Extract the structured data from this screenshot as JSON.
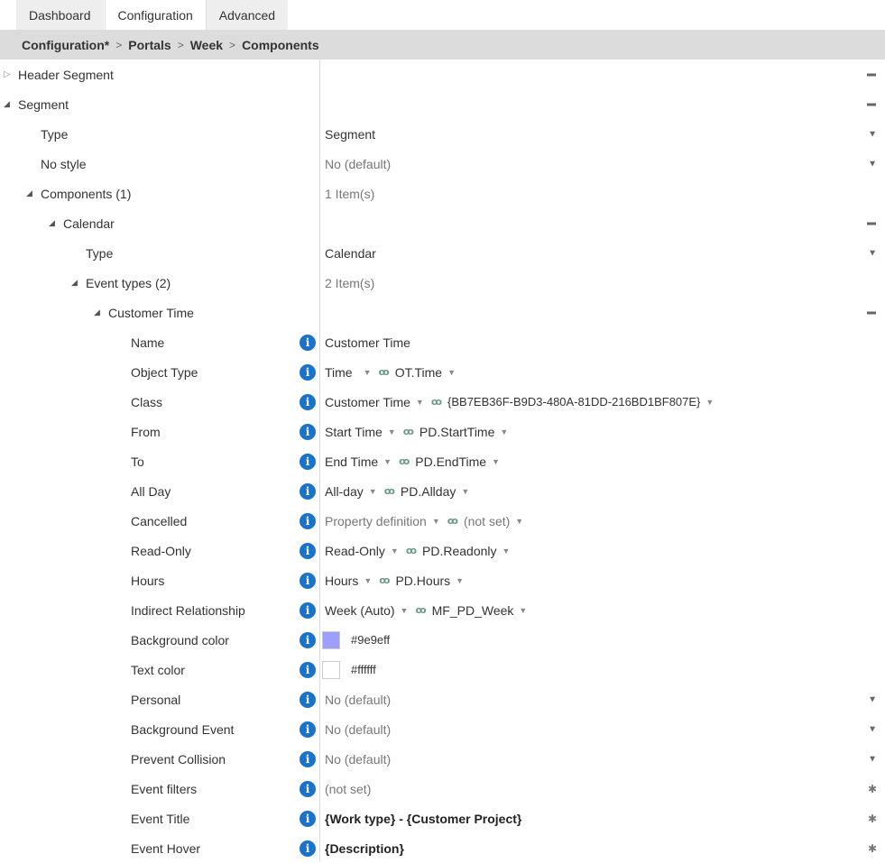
{
  "tabs": [
    {
      "label": "Dashboard",
      "active": false
    },
    {
      "label": "Configuration",
      "active": true
    },
    {
      "label": "Advanced",
      "active": false
    }
  ],
  "breadcrumb": [
    "Configuration*",
    "Portals",
    "Week",
    "Components"
  ],
  "breadcrumb_separator": ">",
  "tree": {
    "header_segment": {
      "label": "Header Segment"
    },
    "segment": {
      "label": "Segment"
    },
    "segment_type": {
      "label": "Type",
      "value": "Segment"
    },
    "segment_no_style": {
      "label": "No style",
      "value": "No (default)"
    },
    "components": {
      "label": "Components (1)",
      "value": "1 Item(s)"
    },
    "calendar": {
      "label": "Calendar"
    },
    "calendar_type": {
      "label": "Type",
      "value": "Calendar"
    },
    "event_types": {
      "label": "Event types (2)",
      "value": "2 Item(s)"
    },
    "customer_time": {
      "label": "Customer Time"
    }
  },
  "props": {
    "name": {
      "label": "Name",
      "value": "Customer Time"
    },
    "object_type": {
      "label": "Object Type",
      "value": "Time",
      "alias": "OT.Time"
    },
    "class": {
      "label": "Class",
      "value": "Customer Time",
      "alias": "{BB7EB36F-B9D3-480A-81DD-216BD1BF807E}"
    },
    "from": {
      "label": "From",
      "value": "Start Time",
      "alias": "PD.StartTime"
    },
    "to": {
      "label": "To",
      "value": "End Time",
      "alias": "PD.EndTime"
    },
    "all_day": {
      "label": "All Day",
      "value": "All-day",
      "alias": "PD.Allday"
    },
    "cancelled": {
      "label": "Cancelled",
      "value": "Property definition",
      "alias": "(not set)"
    },
    "read_only": {
      "label": "Read-Only",
      "value": "Read-Only",
      "alias": "PD.Readonly"
    },
    "hours": {
      "label": "Hours",
      "value": "Hours",
      "alias": "PD.Hours"
    },
    "indirect": {
      "label": "Indirect Relationship",
      "value": "Week (Auto)",
      "alias": "MF_PD_Week"
    },
    "bg_color": {
      "label": "Background color",
      "value": "#9e9eff",
      "color": "#9e9eff"
    },
    "text_color": {
      "label": "Text color",
      "value": "#ffffff",
      "color": "#ffffff"
    },
    "personal": {
      "label": "Personal",
      "value": "No (default)"
    },
    "background_event": {
      "label": "Background Event",
      "value": "No (default)"
    },
    "prevent_collision": {
      "label": "Prevent Collision",
      "value": "No (default)"
    },
    "event_filters": {
      "label": "Event filters",
      "value": "(not set)"
    },
    "event_title": {
      "label": "Event Title",
      "value": "{Work type} - {Customer Project}"
    },
    "event_hover": {
      "label": "Event Hover",
      "value": "{Description}"
    }
  },
  "icons": {
    "collapse": "minus-icon",
    "dropdown": "▼",
    "link": "ꝏ",
    "info": "i",
    "gear": "✱"
  }
}
